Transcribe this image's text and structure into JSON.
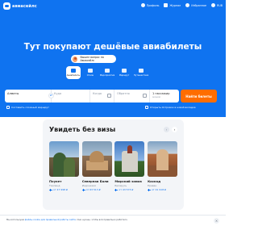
{
  "header": {
    "logo_text": "авиасейлс",
    "nav": [
      {
        "label": "Профиль",
        "icon": "user-icon"
      },
      {
        "label": "Журнал",
        "icon": "journal-icon"
      },
      {
        "label": "Избранное",
        "icon": "heart-icon"
      },
      {
        "label": "RUB",
        "icon": "currency-icon"
      }
    ]
  },
  "hero": {
    "title": "Тут покупают дешёвые авиабилеты",
    "signin_label": "Вышел вопрос на Авиасейлс"
  },
  "modes": [
    {
      "label": "Авиабилеты",
      "icon": "plane-icon",
      "active": true
    },
    {
      "label": "Отели",
      "icon": "hotel-icon",
      "active": false
    },
    {
      "label": "Мероприятия",
      "icon": "event-icon",
      "active": false
    },
    {
      "label": "Маршрут",
      "icon": "route-icon",
      "active": false
    },
    {
      "label": "Путешествия",
      "icon": "suitcase-icon",
      "active": false
    }
  ],
  "search": {
    "from_value": "Алматы",
    "to_placeholder": "Куда",
    "depart_placeholder": "Когда",
    "return_placeholder": "Обратно",
    "passengers_value": "1 пассажир",
    "passengers_class": "эконом",
    "find_label": "Найти билеты"
  },
  "options": {
    "complex_route": "Составить сложный маршрут",
    "open_booking": "Открыть Островок в новой вкладке"
  },
  "visa_free": {
    "title": "Увидеть без визы",
    "prev_icon": "chevron-left-icon",
    "next_icon": "chevron-right-icon",
    "destinations": [
      {
        "name": "Пхукет",
        "country": "Таиланд",
        "price": "от 47 998 ₽"
      },
      {
        "name": "Северная Бали",
        "country": "Индонезия",
        "price": "от 63 513 ₽"
      },
      {
        "name": "Мирский замок",
        "country": "Беларусь",
        "price": "от 43 573 ₽"
      },
      {
        "name": "Каскад",
        "country": "Ереван",
        "price": "от 41 918 ₽"
      }
    ]
  },
  "cookie": {
    "prefix": "Мы используем ",
    "link": "файлы cookie для правильной работы сайта",
    "suffix": ". Они нужны, чтобы всё правильно работало.",
    "close_icon": "close-icon"
  },
  "colors": {
    "brand_blue": "#0f73f0",
    "cta_orange": "#ff6d00",
    "card_bg": "#f3f5f8"
  }
}
